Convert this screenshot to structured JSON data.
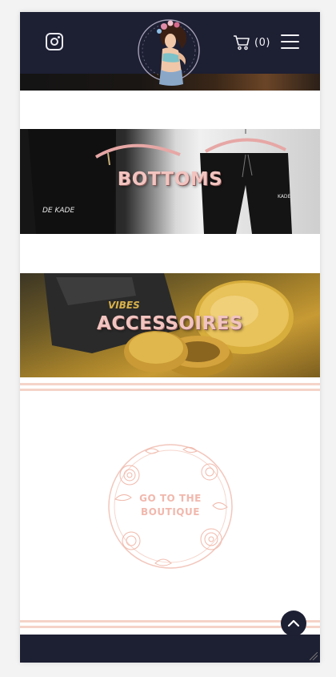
{
  "header": {
    "cart_count": "(0)",
    "icons": {
      "social": "instagram-icon",
      "cart": "cart-icon",
      "menu": "hamburger-menu-icon"
    }
  },
  "categories": [
    {
      "title": "BOTTOMS",
      "brand_text": "DE KADE"
    },
    {
      "title": "ACCESSOIRES",
      "brand_text": "VIBES"
    }
  ],
  "boutique": {
    "line1": "GO TO THE",
    "line2": "BOUTIQUE"
  },
  "colors": {
    "header_bg": "#1d1f33",
    "accent_pink": "#f2c4c0",
    "rule": "#f5d3c8"
  }
}
